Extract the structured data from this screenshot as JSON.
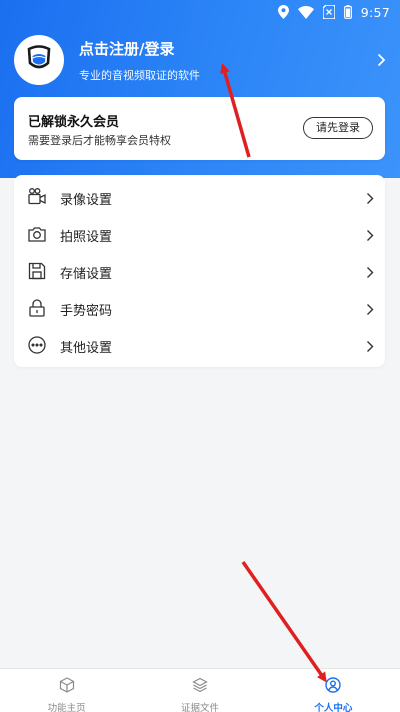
{
  "status_bar": {
    "time": "9:57",
    "icons": [
      "location-icon",
      "wifi-icon",
      "no-sim-icon",
      "battery-icon"
    ]
  },
  "profile": {
    "title": "点击注册/登录",
    "subtitle": "专业的音视频取证的软件"
  },
  "member_card": {
    "title": "已解锁永久会员",
    "subtitle": "需要登录后才能畅享会员特权",
    "login_button": "请先登录"
  },
  "settings": {
    "items": [
      {
        "label": "录像设置",
        "icon": "video-camera-icon"
      },
      {
        "label": "拍照设置",
        "icon": "camera-icon"
      },
      {
        "label": "存储设置",
        "icon": "storage-icon"
      },
      {
        "label": "手势密码",
        "icon": "lock-icon"
      },
      {
        "label": "其他设置",
        "icon": "more-icon"
      }
    ]
  },
  "tabbar": {
    "tabs": [
      {
        "label": "功能主页",
        "icon": "cube-icon",
        "active": false
      },
      {
        "label": "证据文件",
        "icon": "layers-icon",
        "active": false
      },
      {
        "label": "个人中心",
        "icon": "user-icon",
        "active": true
      }
    ]
  },
  "colors": {
    "brand_blue": "#1a6ff0",
    "annotation_red": "#e02020",
    "background": "#f4f5f7"
  }
}
